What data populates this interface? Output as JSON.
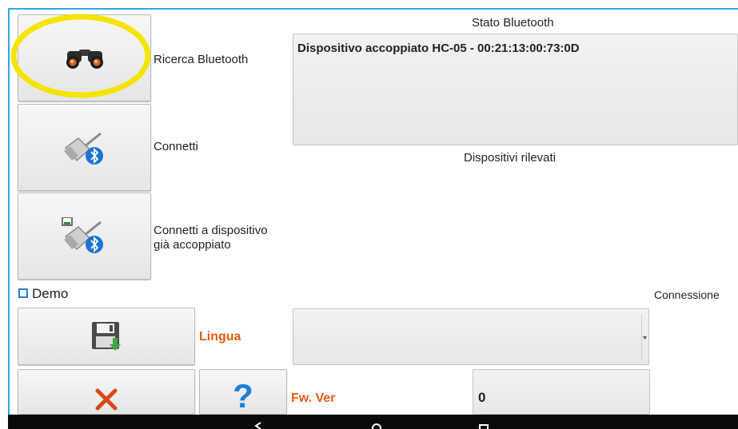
{
  "buttons": {
    "search_label": "Ricerca Bluetooth",
    "connect_label": "Connetti",
    "connect_paired_label_line1": "Connetti a dispositivo",
    "connect_paired_label_line2": "già accoppiato"
  },
  "status": {
    "title": "Stato Bluetooth",
    "text": "Dispositivo accoppiato HC-05 - 00:21:13:00:73:0D",
    "detected_label": "Dispositivi rilevati"
  },
  "demo": {
    "label": "Demo",
    "checked": false
  },
  "connection": {
    "label": "Connessione"
  },
  "language": {
    "label": "Lingua",
    "selected": ""
  },
  "firmware": {
    "label": "Fw. Ver",
    "value": "0"
  },
  "colors": {
    "accent": "#2ea8e0",
    "highlight_circle": "#f5e400",
    "orange_label": "#e85a10"
  },
  "icons": [
    "binoculars-icon",
    "bluetooth-plug-icon",
    "paired-bluetooth-plug-icon",
    "save-disk-icon",
    "close-x-icon",
    "help-question-icon"
  ]
}
